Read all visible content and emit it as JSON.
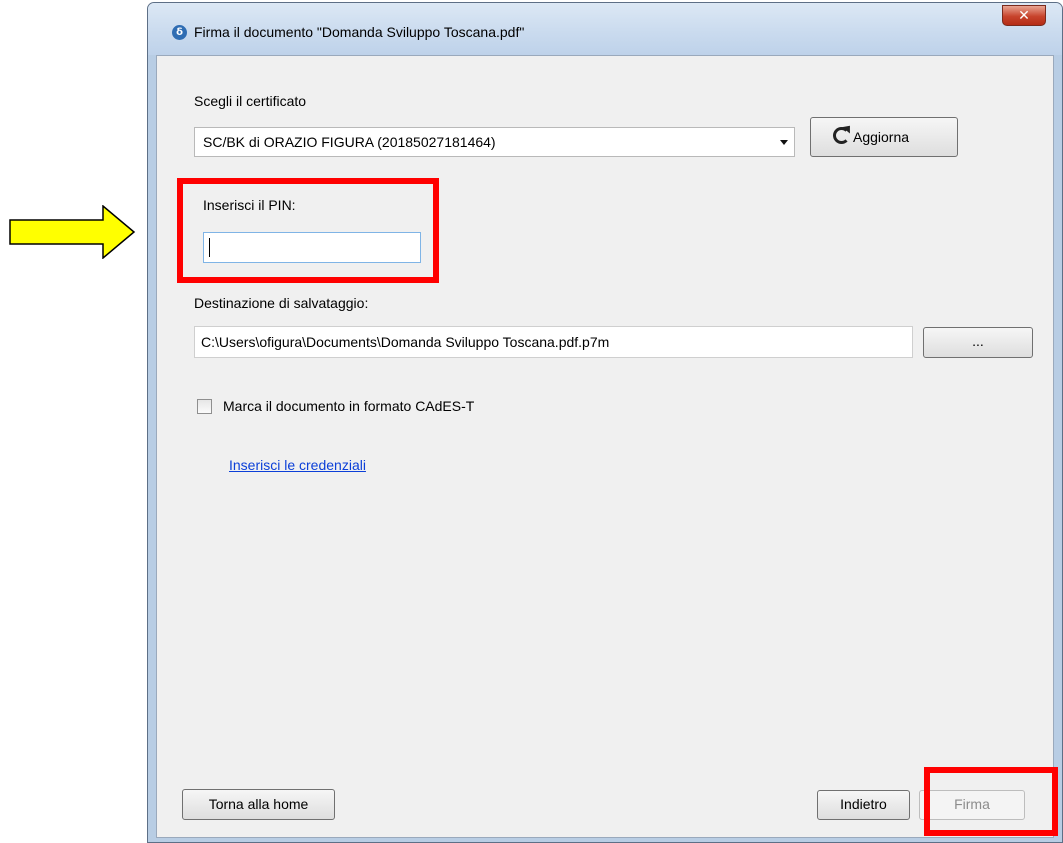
{
  "window": {
    "title": "Firma il documento \"Domanda Sviluppo Toscana.pdf\"",
    "close_label": "✕"
  },
  "certificate": {
    "label": "Scegli il certificato",
    "selected": "SC/BK di ORAZIO FIGURA (20185027181464)",
    "refresh_label": "Aggiorna"
  },
  "pin": {
    "label": "Inserisci il PIN:",
    "value": ""
  },
  "destination": {
    "label": "Destinazione di salvataggio:",
    "value": "C:\\Users\\ofigura\\Documents\\Domanda Sviluppo Toscana.pdf.p7m",
    "browse_label": "..."
  },
  "cades": {
    "label": "Marca il documento in formato CAdES-T",
    "checked": false
  },
  "credentials_link": "Inserisci le credenziali",
  "footer": {
    "home_label": "Torna alla home",
    "back_label": "Indietro",
    "sign_label": "Firma"
  },
  "colors": {
    "highlight": "#ff0000",
    "arrow_fill": "#ffff00",
    "link": "#0b3fd8"
  }
}
